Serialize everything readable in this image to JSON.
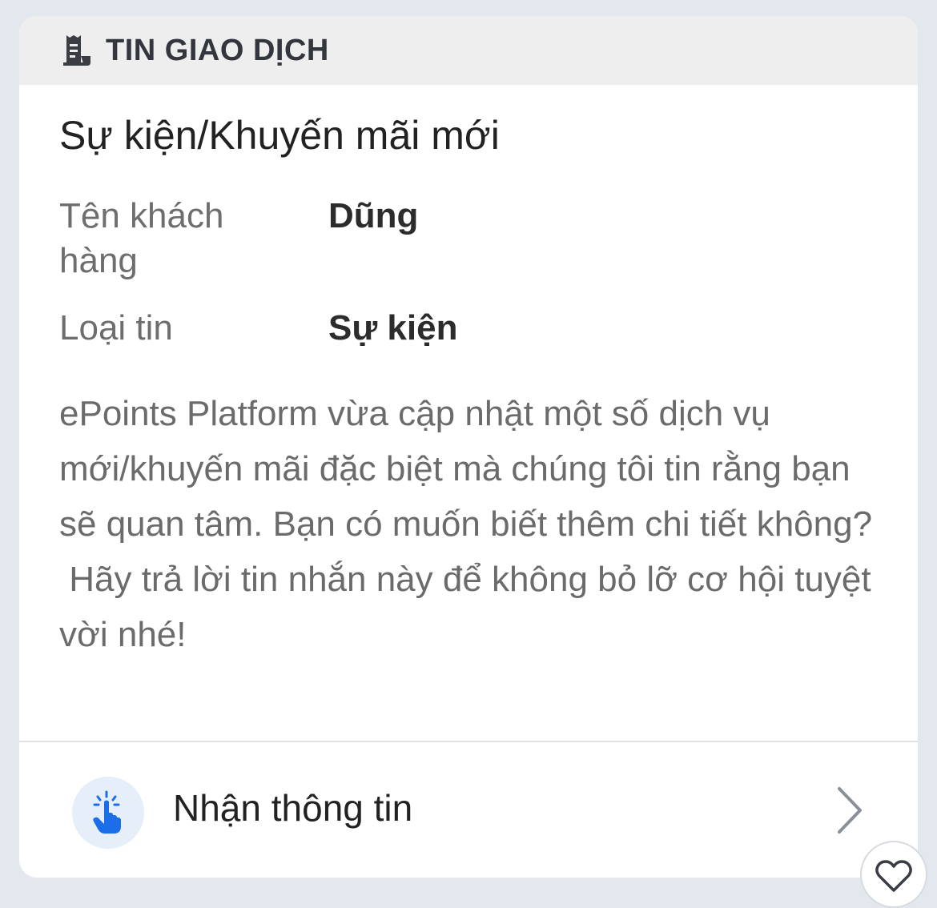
{
  "header": {
    "icon": "receipt-icon",
    "title": "TIN GIAO DỊCH"
  },
  "message": {
    "title": "Sự kiện/Khuyến mãi mới",
    "fields": [
      {
        "label": "Tên khách hàng",
        "value": "Dũng"
      },
      {
        "label": "Loại tin",
        "value": "Sự kiện"
      }
    ],
    "body_lines": [
      "ePoints Platform vừa cập nhật một số dịch vụ mới/khuyến mãi đặc biệt mà chúng tôi tin rằng bạn sẽ quan tâm. Bạn có muốn biết thêm chi tiết không?",
      " Hãy trả lời tin nhắn này để không bỏ lỡ cơ hội tuyệt vời nhé!"
    ]
  },
  "action": {
    "icon": "tap-hand-icon",
    "label": "Nhận thông tin",
    "chevron": "chevron-right-icon"
  },
  "reaction": {
    "icon": "heart-icon"
  },
  "colors": {
    "background": "#e3e8ef",
    "header_bg": "#eeeeee",
    "accent_blue": "#1a6fe8",
    "icon_circle_bg": "#e6eef9"
  }
}
